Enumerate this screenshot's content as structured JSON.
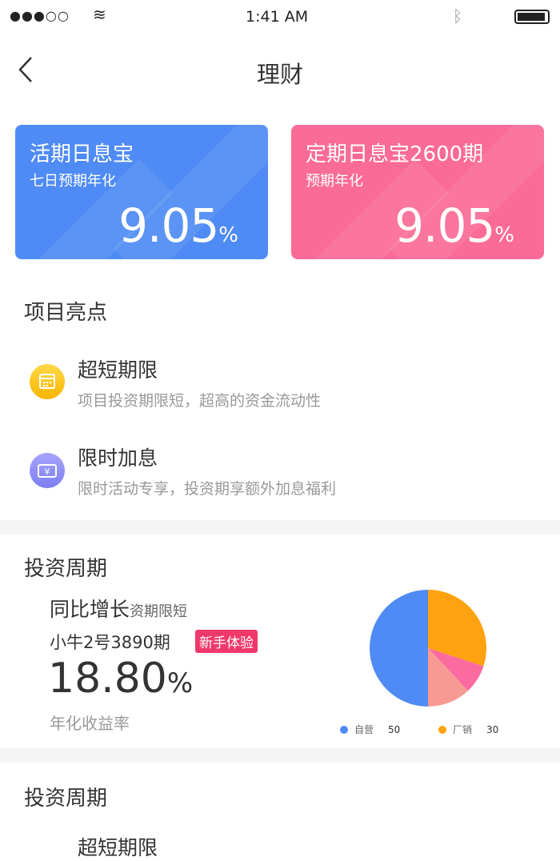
{
  "status": {
    "time": "1:41 AM"
  },
  "header": {
    "title": "理财"
  },
  "cards": [
    {
      "title": "活期日息宝",
      "subtitle": "七日预期年化",
      "value": "9.05",
      "unit": "%",
      "color": "#4f8bf5"
    },
    {
      "title": "定期日息宝2600期",
      "subtitle": "预期年化",
      "value": "9.05",
      "unit": "%",
      "color": "#fb6b97"
    }
  ],
  "highlights": {
    "title": "项目亮点",
    "items": [
      {
        "title": "超短期限",
        "desc": "项目投资期限短，超高的资金流动性",
        "icon": "calendar-icon"
      },
      {
        "title": "限时加息",
        "desc": "限时活动专享，投资期享额外加息福利",
        "icon": "ticket-yen-icon"
      }
    ]
  },
  "invest": {
    "title": "投资周期",
    "headline": "同比增长",
    "headline_sub": "资期限短",
    "product": "小牛2号3890期",
    "badge": "新手体验",
    "rate": "18.80",
    "rate_unit": "%",
    "rate_label": "年化收益率"
  },
  "chart_data": {
    "type": "pie",
    "slices": [
      {
        "name": "自营",
        "value": 50,
        "color": "#4f8bf5"
      },
      {
        "name": "厂销",
        "value": 30,
        "color": "#ffa20f"
      },
      {
        "value": 8,
        "color": "#fb6b9f"
      },
      {
        "value": 12,
        "color": "#f89a94"
      }
    ],
    "legend": [
      {
        "label": "自营",
        "value": "50"
      },
      {
        "label": "厂销",
        "value": "30"
      }
    ],
    "legend_position": "bottom"
  },
  "section2": {
    "title": "投资周期",
    "item": "超短期限"
  }
}
